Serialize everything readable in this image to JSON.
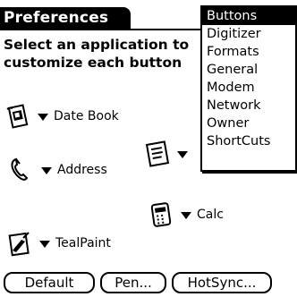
{
  "title": "Preferences",
  "instructions": "Select an application to\ncustomize each button",
  "app_buttons": [
    {
      "icon": "datebook-icon",
      "label": "Date Book"
    },
    {
      "icon": "address-icon",
      "label": "Address"
    },
    {
      "icon": "todo-icon",
      "label": ""
    },
    {
      "icon": "calc-icon",
      "label": "Calc"
    },
    {
      "icon": "tealpaint-icon",
      "label": "TealPaint"
    }
  ],
  "popup_list": {
    "selected": "Buttons",
    "items": [
      "Buttons",
      "Digitizer",
      "Formats",
      "General",
      "Modem",
      "Network",
      "Owner",
      "ShortCuts"
    ]
  },
  "buttons": {
    "default": "Default",
    "pen": "Pen...",
    "hotsync": "HotSync..."
  }
}
